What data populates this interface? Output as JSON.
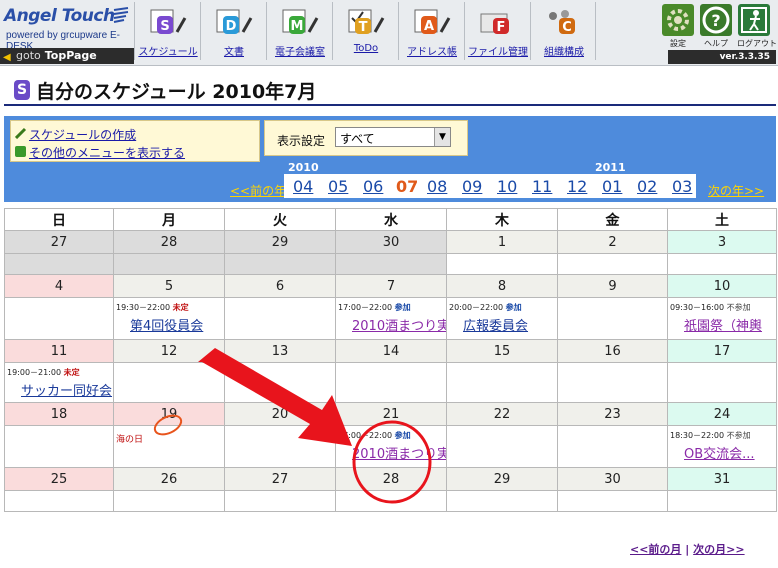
{
  "app": {
    "logo_title": "Angel Touch",
    "logo_sub": "powered by grcupware E-DESK",
    "goto_label": "goto",
    "goto_target": "TopPage",
    "version": "ver.3.3.35"
  },
  "toolbar": [
    {
      "label": "スケジュール",
      "letter": "S",
      "color": "#7a4ad0"
    },
    {
      "label": "文書",
      "letter": "D",
      "color": "#2a9ad8"
    },
    {
      "label": "電子会議室",
      "letter": "M",
      "color": "#3aa83a"
    },
    {
      "label": "ToDo",
      "letter": "T",
      "color": "#e0a020"
    },
    {
      "label": "アドレス帳",
      "letter": "A",
      "color": "#e05a1a"
    },
    {
      "label": "ファイル管理",
      "letter": "F",
      "color": "#d02a2a"
    },
    {
      "label": "組織構成",
      "letter": "C",
      "color": "#d06a10"
    }
  ],
  "right_tools": [
    {
      "label": "設定",
      "color": "#4a8a2a"
    },
    {
      "label": "ヘルプ",
      "color": "#3a7a2a"
    },
    {
      "label": "ログアウト",
      "color": "#2a7a3a"
    }
  ],
  "page_title": "自分のスケジュール 2010年7月",
  "title_icon": "S",
  "menu": {
    "create": "スケジュールの作成",
    "other": "その他のメニューを表示する"
  },
  "filter": {
    "label": "表示設定",
    "value": "すべて"
  },
  "nav": {
    "year_left": "2010",
    "year_right": "2011",
    "prev_year": "<<前の年",
    "next_year": "次の年>>",
    "months": [
      "04",
      "05",
      "06",
      "07",
      "08",
      "09",
      "10",
      "11",
      "12",
      "01",
      "02",
      "03"
    ],
    "current": "07"
  },
  "weekdays": [
    "日",
    "月",
    "火",
    "水",
    "木",
    "金",
    "土"
  ],
  "weeks": [
    {
      "days": [
        "27",
        "28",
        "29",
        "30",
        "1",
        "2",
        "3"
      ],
      "other": [
        0,
        1,
        2,
        3
      ]
    },
    {
      "days": [
        "4",
        "5",
        "6",
        "7",
        "8",
        "9",
        "10"
      ],
      "other": []
    },
    {
      "days": [
        "11",
        "12",
        "13",
        "14",
        "15",
        "16",
        "17"
      ],
      "other": []
    },
    {
      "days": [
        "18",
        "19",
        "20",
        "21",
        "22",
        "23",
        "24"
      ],
      "other": []
    },
    {
      "days": [
        "25",
        "26",
        "27",
        "28",
        "29",
        "30",
        "31"
      ],
      "other": []
    }
  ],
  "events": {
    "w1_mon": {
      "time": "19:30－22:00",
      "status": "未定",
      "title": "第4回役員会"
    },
    "w1_wed": {
      "time": "17:00－22:00",
      "status": "参加",
      "title": "2010酒まつり実"
    },
    "w1_thu": {
      "time": "20:00－22:00",
      "status": "参加",
      "title": "広報委員会"
    },
    "w1_sat": {
      "time": "09:30－16:00",
      "status": "不参加",
      "title": "祇園祭（神輿"
    },
    "w2_sun": {
      "time": "19:00－21:00",
      "status": "未定",
      "title": "サッカー同好会"
    },
    "w3_mon": {
      "holiday": "海の日"
    },
    "w3_wed": {
      "time": "17:00－22:00",
      "status": "参加",
      "title": "2010酒まつり実"
    },
    "w3_sat": {
      "time": "18:30－22:00",
      "status": "不参加",
      "title": "OB交流会..."
    }
  },
  "footer": {
    "prev": "<<前の月",
    "sep": "|",
    "next": "次の月>>"
  }
}
